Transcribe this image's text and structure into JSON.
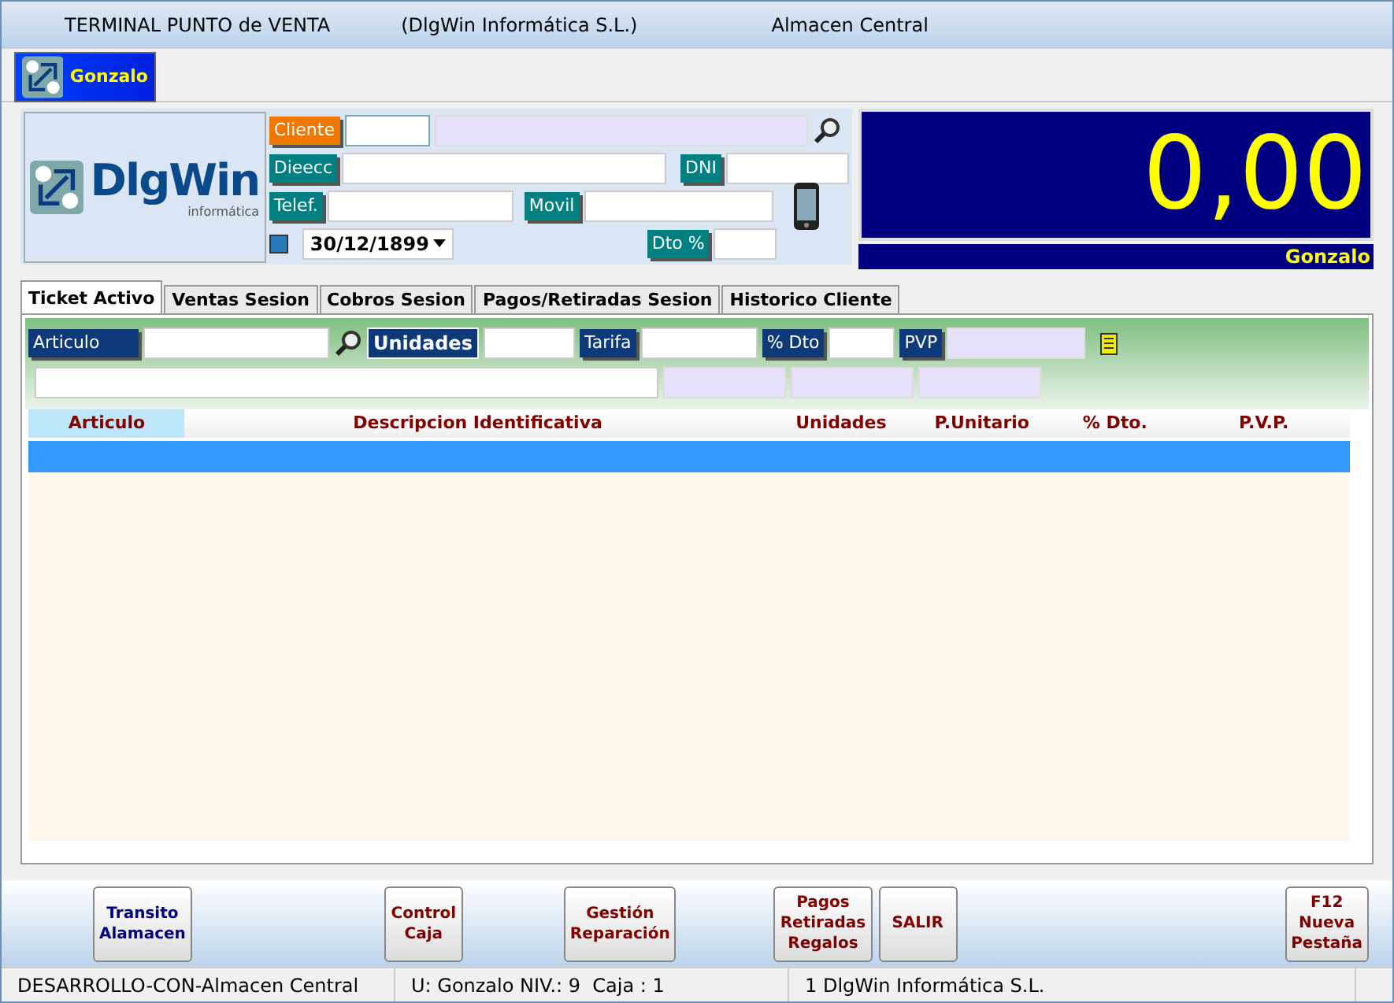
{
  "window": {
    "title_parts": [
      "TERMINAL PUNTO de VENTA",
      "(DlgWin Informática S.L.)",
      "Almacen Central"
    ]
  },
  "user_tab": {
    "label": "Gonzalo",
    "selected": true
  },
  "logo": {
    "name": "DlgWin",
    "tagline": "informática"
  },
  "customer": {
    "cliente_label": "Cliente",
    "direccion_label": "Dieecc",
    "dni_label": "DNI",
    "telefono_label": "Telef.",
    "movil_label": "Movil",
    "date": "30/12/1899",
    "date_checked": false,
    "dto_label": "Dto %"
  },
  "total": {
    "amount": "0,00",
    "operator": "Gonzalo"
  },
  "tabs": [
    {
      "label": "Ticket Activo",
      "selected": true
    },
    {
      "label": "Ventas Sesion",
      "selected": false
    },
    {
      "label": "Cobros  Sesion",
      "selected": false
    },
    {
      "label": "Pagos/Retiradas Sesion",
      "selected": false
    },
    {
      "label": "Historico Cliente",
      "selected": false
    }
  ],
  "article_form": {
    "articulo_label": "Articulo",
    "unidades_label": "Unidades",
    "tarifa_label": "Tarifa",
    "dto_label": "% Dto",
    "pvp_label": "PVP"
  },
  "table": {
    "columns": [
      "Articulo",
      "Descripcion Identificativa",
      "Unidades",
      "P.Unitario",
      "% Dto.",
      "P.V.P."
    ]
  },
  "buttons": [
    {
      "label": "Transito\nAlamacen",
      "color": "#000080"
    },
    {
      "label": "Control\nCaja",
      "color": "#800000"
    },
    {
      "label": "Gestión\nReparación",
      "color": "#800000"
    },
    {
      "label": "Pagos\nRetiradas\nRegalos",
      "color": "#800000"
    },
    {
      "label": "SALIR",
      "color": "#800000"
    },
    {
      "label": "F12\nNueva\nPestaña",
      "color": "#800000"
    }
  ],
  "status_bar": [
    "DESARROLLO-CON-Almacen Central",
    "U: Gonzalo NIV.: 9  Caja : 1",
    "1 DlgWin Informática S.L."
  ]
}
